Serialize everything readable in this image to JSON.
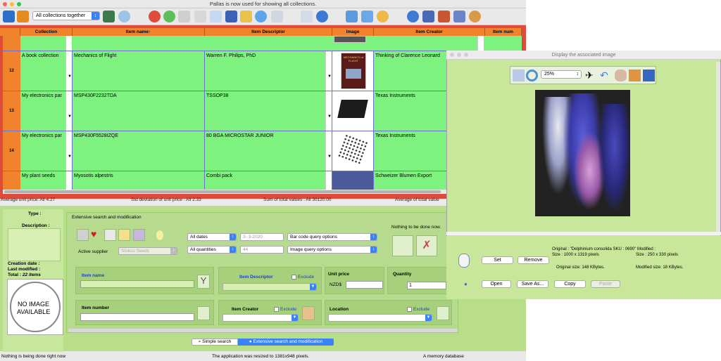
{
  "window_title": "Pallas is now used for showing all collections.",
  "collection_selector": "All collections together",
  "columns": [
    "Collection",
    "Item name↑",
    "Item Descriptor",
    "Image",
    "Item Creator",
    "Item num"
  ],
  "rows": [
    {
      "num": "12",
      "collection": "A book collection",
      "name": "Mechanics of Flight",
      "descriptor": "Warren F. Philips, PhD",
      "creator": "Thinking of Clarence Leonard"
    },
    {
      "num": "13",
      "collection": "My electronics par",
      "name": "MSP430F2232TDA",
      "descriptor": "TSSOP38",
      "creator": "Texas Instruments"
    },
    {
      "num": "14",
      "collection": "My electronics par",
      "name": "MSP430F5528IZQE",
      "descriptor": "80 BGA MICROSTAR JUNIOR",
      "creator": "Texas Instruments"
    },
    {
      "num": "",
      "collection": "My plant seeds",
      "name": "Myosotis alpestris",
      "descriptor": "Combi pack",
      "creator": "Schweizer Blumen Export"
    }
  ],
  "thumb_book_text": "MECHANICS of FLIGHT",
  "stats": {
    "average": "Average unit price: All 4.27",
    "stddev": "Std deviation of unit price :  All 2.33",
    "sum": "Sum of total values : All 30120.00",
    "average_total": "Average of total value"
  },
  "left_panel": {
    "type_label": "Type :",
    "description_label": "Description :",
    "creation_label": "Creation date :",
    "modified_label": "Last modified :",
    "total_label": "Total :",
    "total_value": "22 items",
    "no_image_line1": "NO IMAGE",
    "no_image_line2": "AVAILABLE"
  },
  "search": {
    "title": "Extensive search and modification",
    "dates_select": "All dates",
    "date_value": "3- 3-2020",
    "quantities_select": "All quantities",
    "quantity_value": "44",
    "barcode_select": "Bar code query options",
    "image_select": "Image query options",
    "nothing_label": "Nothing to be done now.",
    "active_supplier_label": "Active supplier",
    "active_supplier_value": "Stokus Seeds",
    "item_name_label": "Item name",
    "item_descriptor_label": "Item Descriptor",
    "exclude_label": "Exclude",
    "unit_price_label": "Unit price",
    "currency": "NZD$",
    "quantity_label": "Quantity",
    "quantity_field": "1",
    "item_number_label": "Item number",
    "item_creator_label": "Item Creator",
    "location_label": "Location",
    "y_button": "Y"
  },
  "tabs": {
    "simple": "Simple search",
    "extensive": "Extensive search and modification"
  },
  "status": {
    "left": "Nothing is being done right now",
    "center": "The application was resized to 1381x948 pixels.",
    "right": "A memory database"
  },
  "image_window": {
    "title": "Display the associated image",
    "zoom": "25%",
    "original_name": "Original : \"Delphinium consolida SKU : 0690\" Modified :",
    "original_size": "Size : 1000 x 1319 pixels",
    "modified_size": "Size : 250 x 330 pixels",
    "original_kbytes": "Original size: 148 KBytes.",
    "modified_kbytes": "Modified size: 18 KBytes.",
    "buttons": {
      "set": "Set",
      "remove": "Remove",
      "open": "Open",
      "save_as": "Save As...",
      "copy": "Copy",
      "paste": "Paste"
    }
  },
  "colors": {
    "grid_bg": "#e04a3a",
    "row_green": "#7ef27e",
    "header_orange": "#f0832c",
    "panel_green": "#b8de8a",
    "accent_blue": "#3b82f6"
  }
}
